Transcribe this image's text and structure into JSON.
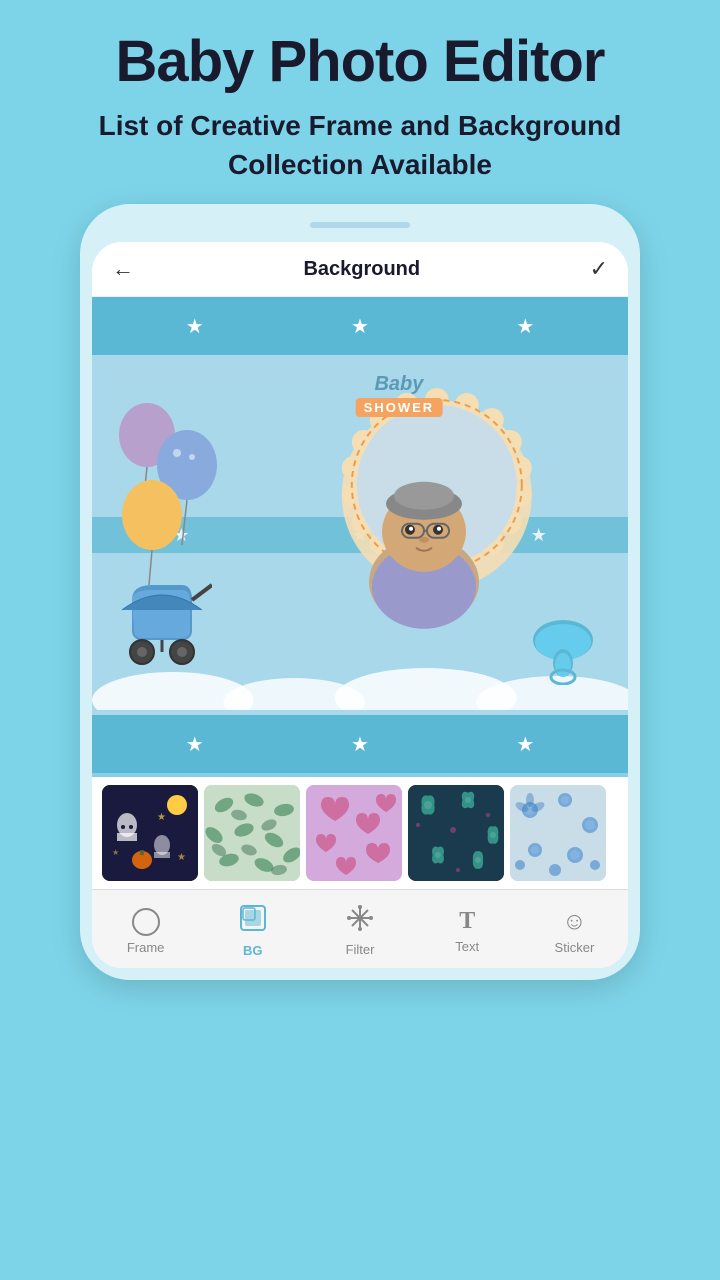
{
  "header": {
    "title": "Baby Photo Editor",
    "subtitle": "List of Creative Frame and Background Collection Available"
  },
  "appBar": {
    "back_label": "←",
    "title": "Background",
    "check_label": "✓"
  },
  "canvas": {
    "frame_text_baby": "Baby",
    "frame_text_shower": "SHOWER"
  },
  "thumbnails": [
    {
      "id": "thumb-dark-ghost",
      "label": "Dark Ghost"
    },
    {
      "id": "thumb-green-leaf",
      "label": "Green Leaf"
    },
    {
      "id": "thumb-pink-hearts",
      "label": "Pink Hearts"
    },
    {
      "id": "thumb-dark-floral",
      "label": "Dark Floral"
    },
    {
      "id": "thumb-light-floral",
      "label": "Light Floral"
    }
  ],
  "bottomNav": {
    "items": [
      {
        "id": "frame",
        "label": "Frame",
        "icon": "○",
        "active": false
      },
      {
        "id": "bg",
        "label": "BG",
        "icon": "▣",
        "active": true
      },
      {
        "id": "filter",
        "label": "Filter",
        "icon": "✳",
        "active": false
      },
      {
        "id": "text",
        "label": "Text",
        "icon": "T",
        "active": false
      },
      {
        "id": "sticker",
        "label": "Sticker",
        "icon": "☺",
        "active": false
      }
    ]
  },
  "colors": {
    "background": "#7dd4e8",
    "accent": "#5bb8d4",
    "nav_active": "#5bb8d4"
  }
}
